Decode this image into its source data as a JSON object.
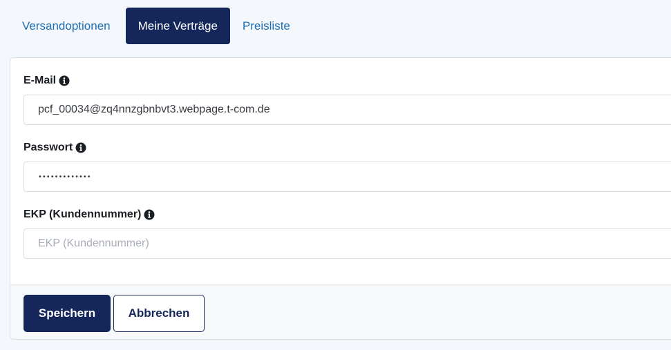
{
  "tabs": [
    {
      "label": "Versandoptionen",
      "active": false
    },
    {
      "label": "Meine Verträge",
      "active": true
    },
    {
      "label": "Preisliste",
      "active": false
    }
  ],
  "form": {
    "email": {
      "label": "E-Mail",
      "value": "pcf_00034@zq4nnzgbnbvt3.webpage.t-com.de",
      "icon": "info-icon"
    },
    "password": {
      "label": "Passwort",
      "value": "•••••••••••••",
      "icon": "info-icon"
    },
    "ekp": {
      "label": "EKP (Kundennummer)",
      "value": "",
      "placeholder": "EKP (Kundennummer)",
      "icon": "info-icon"
    }
  },
  "footer": {
    "save_label": "Speichern",
    "cancel_label": "Abbrechen"
  },
  "colors": {
    "primary": "#15275a",
    "link": "#1f6fb5",
    "page_bg": "#f4f7fc"
  }
}
